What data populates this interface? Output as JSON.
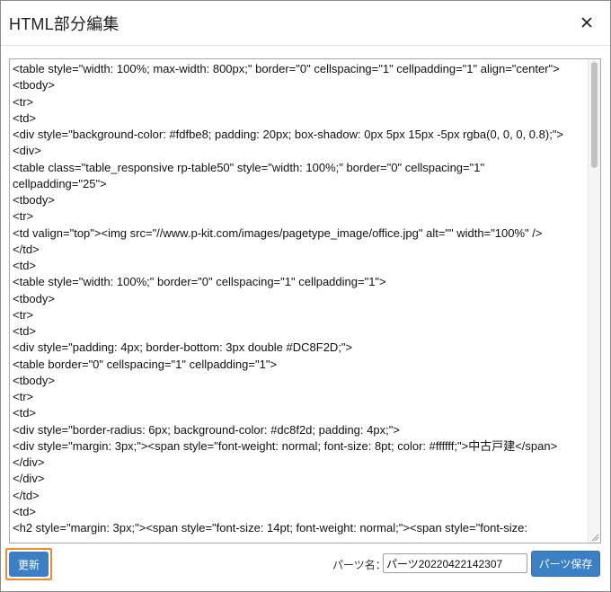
{
  "dialog": {
    "title": "HTML部分編集",
    "close_icon": "close-icon"
  },
  "editor": {
    "lines": [
      "<table style=\"width: 100%; max-width: 800px;\" border=\"0\" cellspacing=\"1\" cellpadding=\"1\" align=\"center\">",
      "<tbody>",
      "<tr>",
      "<td>",
      "<div style=\"background-color: #fdfbe8; padding: 20px; box-shadow: 0px 5px 15px -5px rgba(0, 0, 0, 0.8);\">",
      "<div>",
      "<table class=\"table_responsive rp-table50\" style=\"width: 100%;\" border=\"0\" cellspacing=\"1\"",
      "cellpadding=\"25\">",
      "<tbody>",
      "<tr>",
      "<td valign=\"top\"><img src=\"//www.p-kit.com/images/pagetype_image/office.jpg\" alt=\"\" width=\"100%\" />",
      "</td>",
      "<td>",
      "<table style=\"width: 100%;\" border=\"0\" cellspacing=\"1\" cellpadding=\"1\">",
      "<tbody>",
      "<tr>",
      "<td>",
      "<div style=\"padding: 4px; border-bottom: 3px double #DC8F2D;\">",
      "<table border=\"0\" cellspacing=\"1\" cellpadding=\"1\">",
      "<tbody>",
      "<tr>",
      "<td>",
      "<div style=\"border-radius: 6px; background-color: #dc8f2d; padding: 4px;\">",
      "<div style=\"margin: 3px;\"><span style=\"font-weight: normal; font-size: 8pt; color: #ffffff;\">中古戸建</span>",
      "</div>",
      "</div>",
      "</td>",
      "<td>",
      "<h2 style=\"margin: 3px;\"><span style=\"font-size: 14pt; font-weight: normal;\"><span style=\"font-size:"
    ]
  },
  "footer": {
    "update_label": "更新",
    "parts_name_label": "パーツ名：",
    "parts_name_value": "パーツ20220422142307",
    "save_label": "パーツ保存"
  },
  "colors": {
    "button_blue": "#3b7fc4",
    "highlight_orange": "#f08a2c"
  }
}
